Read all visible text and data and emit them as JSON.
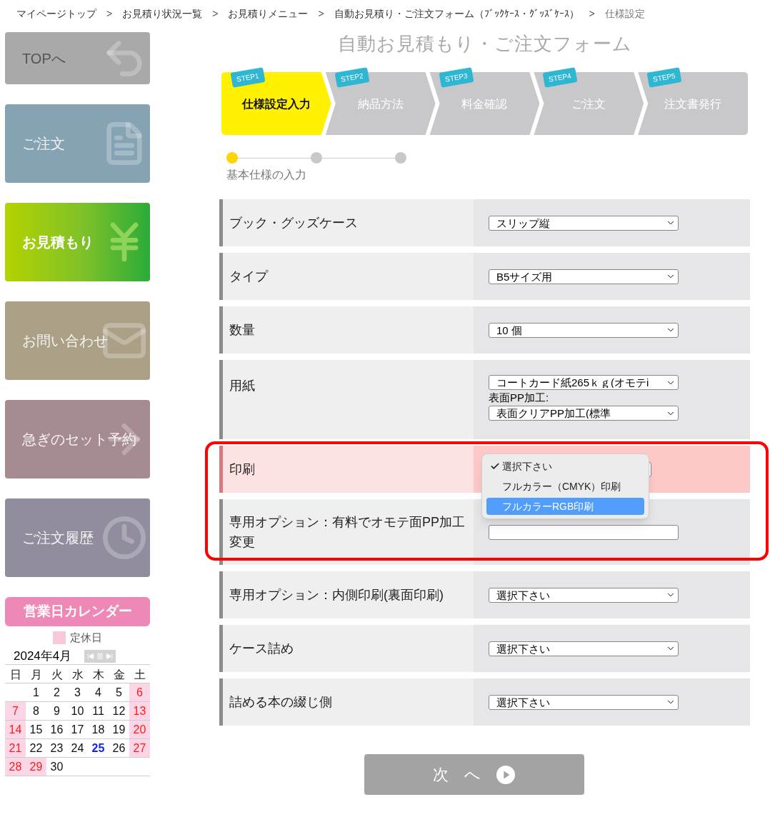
{
  "breadcrumb": [
    {
      "text": "マイページトップ",
      "current": false
    },
    {
      "text": "お見積り状況一覧",
      "current": false
    },
    {
      "text": "お見積りメニュー",
      "current": false
    },
    {
      "text": "自動お見積り・ご注文フォーム（ﾌﾞｯｸｹｰｽ・ｸﾞｯｽﾞｹｰｽ）",
      "current": false
    },
    {
      "text": "仕様設定",
      "current": true
    }
  ],
  "breadcrumb_separator": ">",
  "sidebar": {
    "items": [
      {
        "label": "TOPへ",
        "selected": false,
        "color": "#a9a9a9"
      },
      {
        "label": "ご注文",
        "selected": false,
        "color": "#86a3b4"
      },
      {
        "label": "お見積もり",
        "selected": true,
        "color": "#7dc12a"
      },
      {
        "label": "お問い合わせ",
        "selected": false,
        "color": "#ab9f86"
      },
      {
        "label": "急ぎのセット予約",
        "selected": false,
        "color": "#a68b90"
      },
      {
        "label": "ご注文履歴",
        "selected": false,
        "color": "#918c9e"
      }
    ]
  },
  "calendar": {
    "title": "営業日カレンダー",
    "legend": "定休日",
    "month": "2024年4月",
    "weekdays": [
      "日",
      "月",
      "火",
      "水",
      "木",
      "金",
      "土"
    ],
    "weeks": [
      [
        {
          "day": "1",
          "holiday": false,
          "today": false
        },
        {
          "day": "2",
          "holiday": false,
          "today": false
        },
        {
          "day": "3",
          "holiday": false,
          "today": false
        },
        {
          "day": "4",
          "holiday": false,
          "today": false
        },
        {
          "day": "5",
          "holiday": false,
          "today": false
        },
        {
          "day": "6",
          "holiday": true,
          "today": false
        }
      ],
      [
        {
          "day": "7",
          "holiday": true,
          "today": false
        },
        {
          "day": "8",
          "holiday": false,
          "today": false
        },
        {
          "day": "9",
          "holiday": false,
          "today": false
        },
        {
          "day": "10",
          "holiday": false,
          "today": false
        },
        {
          "day": "11",
          "holiday": false,
          "today": false
        },
        {
          "day": "12",
          "holiday": false,
          "today": false
        },
        {
          "day": "13",
          "holiday": true,
          "today": false
        }
      ],
      [
        {
          "day": "14",
          "holiday": true,
          "today": false
        },
        {
          "day": "15",
          "holiday": false,
          "today": false
        },
        {
          "day": "16",
          "holiday": false,
          "today": false
        },
        {
          "day": "17",
          "holiday": false,
          "today": false
        },
        {
          "day": "18",
          "holiday": false,
          "today": false
        },
        {
          "day": "19",
          "holiday": false,
          "today": false
        },
        {
          "day": "20",
          "holiday": true,
          "today": false
        }
      ],
      [
        {
          "day": "21",
          "holiday": true,
          "today": false
        },
        {
          "day": "22",
          "holiday": false,
          "today": false
        },
        {
          "day": "23",
          "holiday": false,
          "today": false
        },
        {
          "day": "24",
          "holiday": false,
          "today": false
        },
        {
          "day": "25",
          "holiday": false,
          "today": true
        },
        {
          "day": "26",
          "holiday": false,
          "today": false
        },
        {
          "day": "27",
          "holiday": true,
          "today": false
        }
      ],
      [
        {
          "day": "28",
          "holiday": true,
          "today": false
        },
        {
          "day": "29",
          "holiday": true,
          "today": false
        },
        {
          "day": "30",
          "holiday": false,
          "today": false
        }
      ]
    ]
  },
  "page_title": "自動お見積もり・ご注文フォーム",
  "steps": [
    {
      "badge": "STEP1",
      "label": "仕様設定入力",
      "selected": true
    },
    {
      "badge": "STEP2",
      "label": "納品方法",
      "selected": false
    },
    {
      "badge": "STEP3",
      "label": "料金確認",
      "selected": false
    },
    {
      "badge": "STEP4",
      "label": "ご注文",
      "selected": false
    },
    {
      "badge": "STEP5",
      "label": "注文書発行",
      "selected": false
    }
  ],
  "progress": {
    "dots": [
      {
        "selected": true
      },
      {
        "selected": false
      },
      {
        "selected": false
      }
    ],
    "label": "基本仕様の入力"
  },
  "form_rows": [
    {
      "label": "ブック・グッズケース",
      "highlighted": false,
      "fields": [
        {
          "kind": "select",
          "value": "スリップ縦"
        }
      ]
    },
    {
      "label": "タイプ",
      "highlighted": false,
      "fields": [
        {
          "kind": "select",
          "value": "B5サイズ用"
        }
      ]
    },
    {
      "label": "数量",
      "highlighted": false,
      "fields": [
        {
          "kind": "select",
          "value": "10 個"
        }
      ]
    },
    {
      "label": "用紙",
      "highlighted": false,
      "fields": [
        {
          "kind": "select",
          "value": "コートカード紙265ｋｇ(オモテi"
        },
        {
          "kind": "caption",
          "value": "表面PP加工:"
        },
        {
          "kind": "select",
          "value": "表面クリアPP加工(標準"
        }
      ]
    },
    {
      "label": "印刷",
      "highlighted": true,
      "fields": [
        {
          "kind": "open-select"
        }
      ],
      "menu": [
        {
          "text": "選択下さい",
          "checked": true,
          "selected": false
        },
        {
          "text": "フルカラー（CMYK）印刷",
          "checked": false,
          "selected": false
        },
        {
          "text": "フルカラーRGB印刷",
          "checked": false,
          "selected": true
        }
      ]
    },
    {
      "label": "専用オプション：有料でオモテ面PP加工変更",
      "highlighted": false,
      "fields": [
        {
          "kind": "covered-select"
        }
      ]
    },
    {
      "label": "専用オプション：内側印刷(裏面印刷)",
      "highlighted": false,
      "fields": [
        {
          "kind": "select",
          "value": "選択下さい"
        }
      ]
    },
    {
      "label": "ケース詰め",
      "highlighted": false,
      "fields": [
        {
          "kind": "select",
          "value": "選択下さい"
        }
      ]
    },
    {
      "label": "詰める本の綴じ側",
      "highlighted": false,
      "fields": [
        {
          "kind": "select",
          "value": "選択下さい"
        }
      ]
    }
  ],
  "next_button": "次 へ"
}
